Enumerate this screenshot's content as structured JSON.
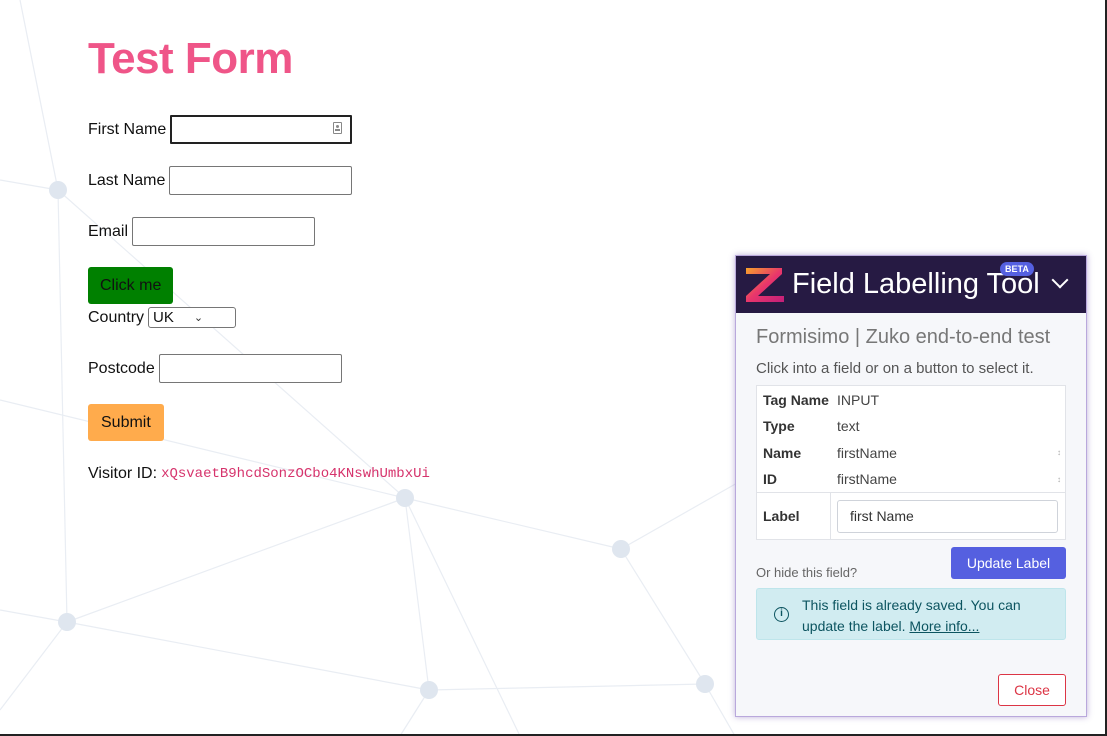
{
  "form": {
    "title": "Test Form",
    "first_name_label": "First Name",
    "first_name_value": "",
    "last_name_label": "Last Name",
    "email_label": "Email",
    "click_me_label": "Click me",
    "country_label": "Country",
    "country_selected": "UK",
    "postcode_label": "Postcode",
    "submit_label": "Submit",
    "visitor_id_label": "Visitor ID:",
    "visitor_id_value": "xQsvaetB9hcdSonzOCbo4KNswhUmbxUi"
  },
  "panel": {
    "title": "Field Labelling Tool",
    "badge": "BETA",
    "subtitle": "Formisimo | Zuko end-to-end test",
    "hint": "Click into a field or on a button to select it.",
    "rows": [
      {
        "key": "Tag Name",
        "value": "INPUT"
      },
      {
        "key": "Type",
        "value": "text"
      },
      {
        "key": "Name",
        "value": "firstName"
      },
      {
        "key": "ID",
        "value": "firstName"
      }
    ],
    "label_key": "Label",
    "label_value": "first Name",
    "hide_link": "Or hide this field?",
    "update_button": "Update Label",
    "alert_text": "This field is already saved. You can update the label.",
    "alert_link": "More info...",
    "close_button": "Close"
  },
  "colors": {
    "title": "#ef5588",
    "panel_header": "#261a43",
    "accent": "#5560e0",
    "green_button": "#008000",
    "orange_button": "#ffab4c",
    "danger": "#dc3545"
  }
}
